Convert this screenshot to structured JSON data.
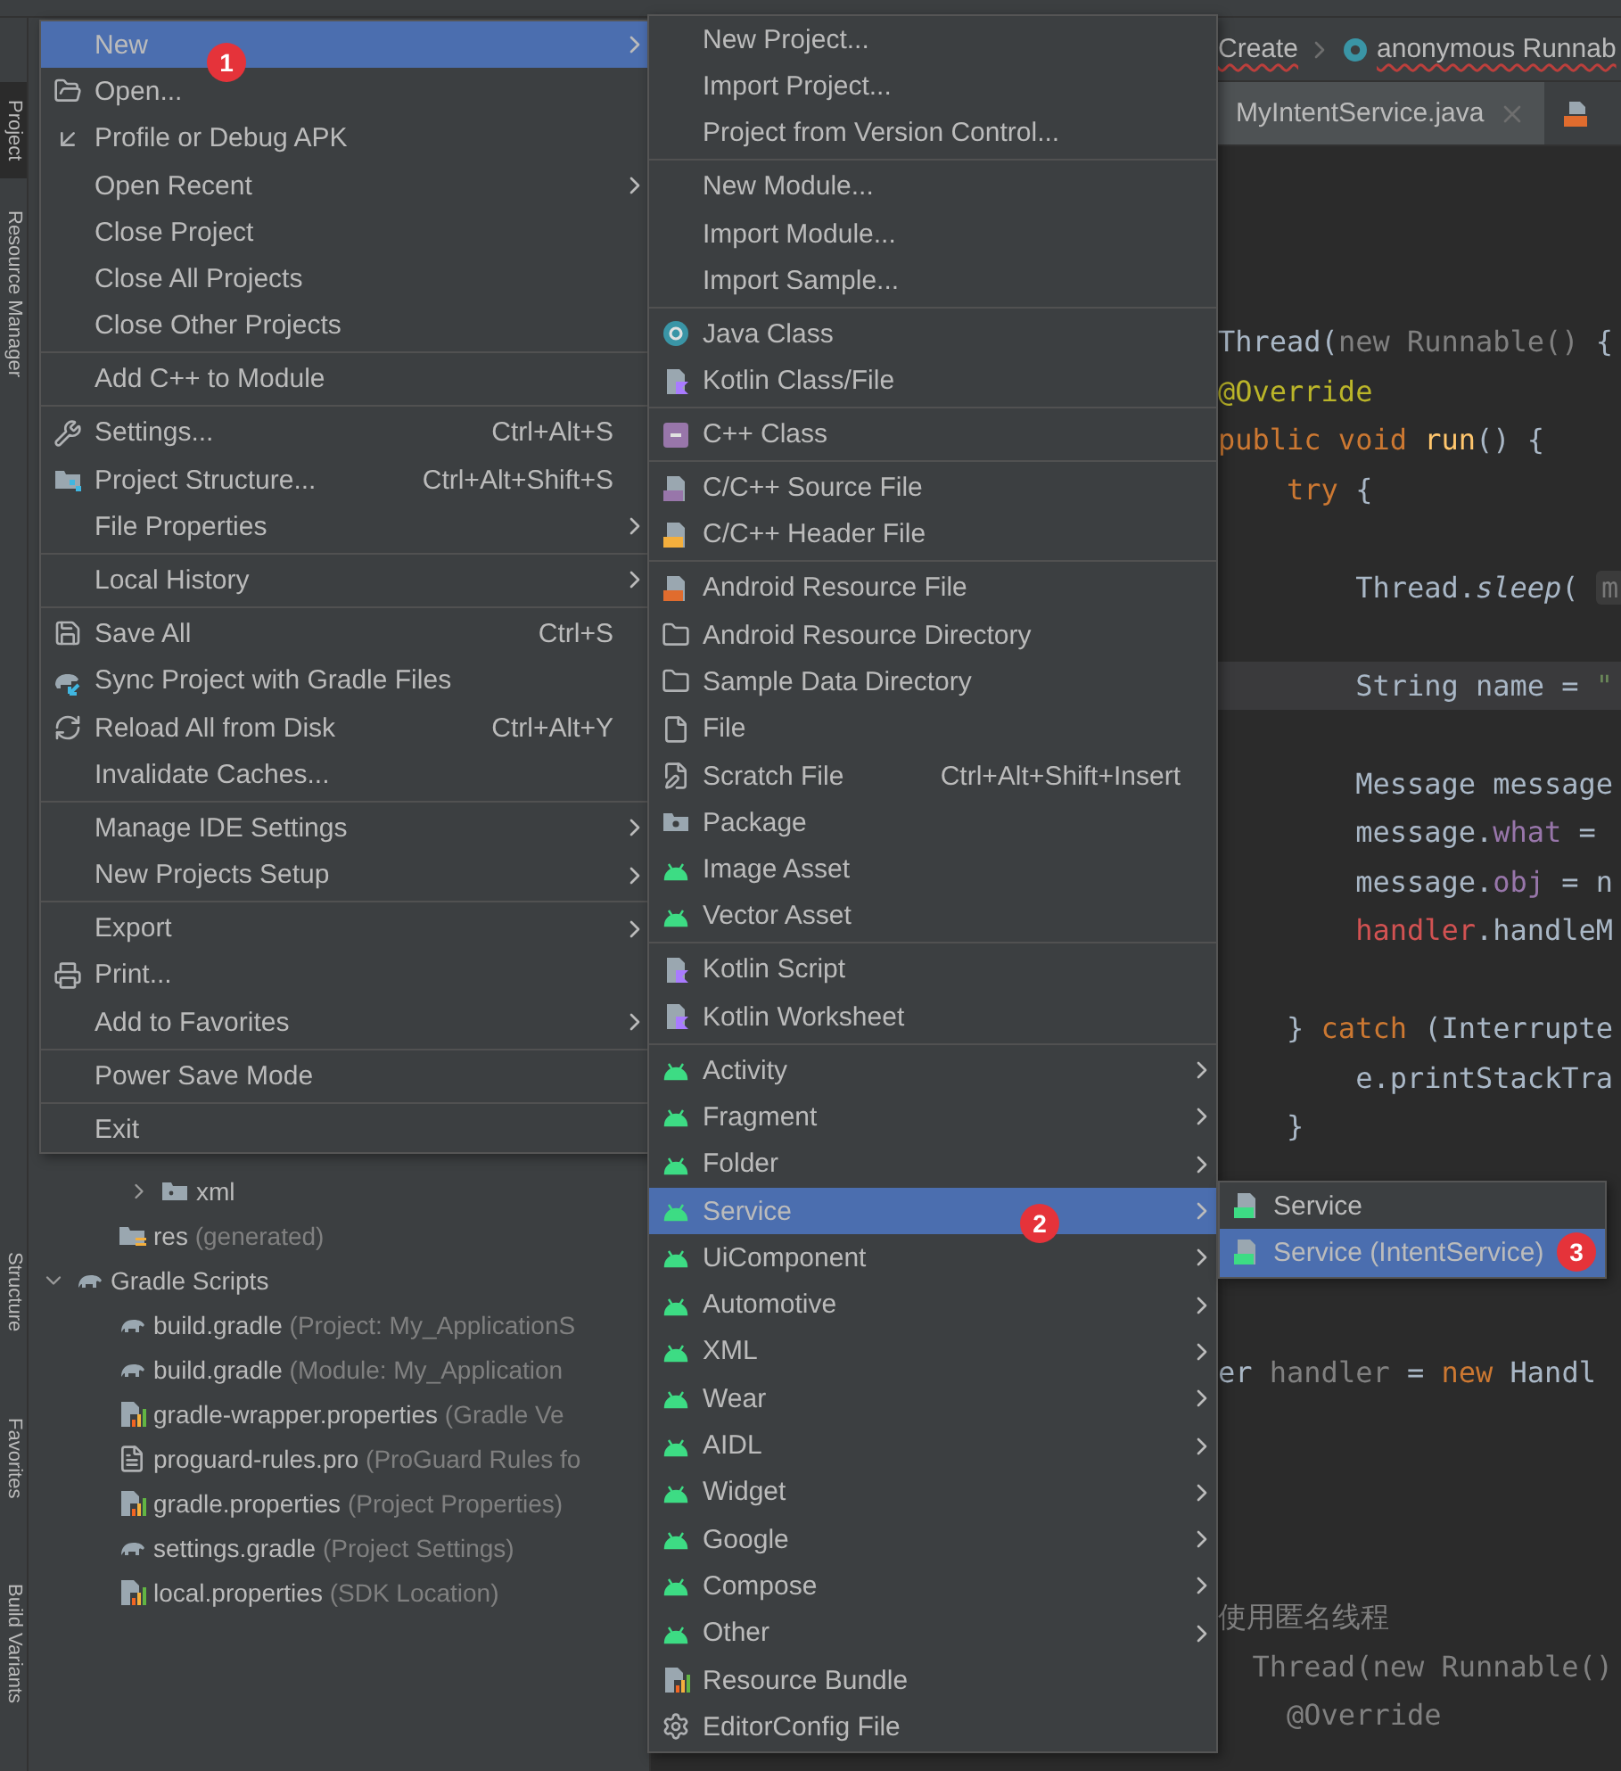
{
  "side_strip": {
    "top_tabs": [
      {
        "label": "Project",
        "selected": true
      },
      {
        "label": "Resource Manager",
        "selected": false
      }
    ],
    "bottom_tabs": [
      {
        "label": "Structure",
        "selected": false
      },
      {
        "label": "Favorites",
        "selected": false
      },
      {
        "label": "Build Variants",
        "selected": false
      }
    ]
  },
  "tree": [
    {
      "children": [
        {
          "children": [
            {
              "label": "xml",
              "expanded": false
            }
          ]
        },
        {
          "label": "res",
          "note": "(generated)"
        }
      ]
    },
    {
      "label": "Gradle Scripts",
      "expanded": true,
      "children": [
        {
          "label": "build.gradle",
          "note": "(Project: My_ApplicationS"
        },
        {
          "label": "build.gradle",
          "note": "(Module: My_Application"
        },
        {
          "label": "gradle-wrapper.properties",
          "note": "(Gradle Ve"
        },
        {
          "label": "proguard-rules.pro",
          "note": "(ProGuard Rules fo"
        },
        {
          "label": "gradle.properties",
          "note": "(Project Properties)"
        },
        {
          "label": "settings.gradle",
          "note": "(Project Settings)"
        },
        {
          "label": "local.properties",
          "note": "(SDK Location)"
        }
      ]
    }
  ],
  "breadcrumb": [
    {
      "label": "Create",
      "error": true
    },
    {
      "label": "anonymous Runnab",
      "error": true
    }
  ],
  "editor_tabs": [
    {
      "label": "MyIntentService.java",
      "selected": true
    }
  ],
  "code_lines": [
    {
      "kind": "code",
      "current": false,
      "segments": [
        {
          "kind": "plain",
          "text": "Thread("
        },
        {
          "kind": "muted",
          "text": "new Runnable()"
        },
        {
          "kind": "plain",
          "text": " {"
        }
      ]
    },
    {
      "kind": "code",
      "current": false,
      "segments": [
        {
          "kind": "annotation",
          "text": "@Override"
        }
      ]
    },
    {
      "kind": "code",
      "current": false,
      "segments": [
        {
          "kind": "keyword",
          "text": "public void "
        },
        {
          "kind": "method",
          "text": "run"
        },
        {
          "kind": "plain",
          "text": "() {"
        }
      ]
    },
    {
      "kind": "code",
      "current": false,
      "segments": [
        {
          "kind": "keyword",
          "text": "    try"
        },
        {
          "kind": "plain",
          "text": " {"
        }
      ]
    },
    {
      "kind": "blank"
    },
    {
      "kind": "code",
      "current": false,
      "segments": [
        {
          "kind": "plain",
          "text": "        Thread."
        },
        {
          "kind": "static",
          "text": "sleep"
        },
        {
          "kind": "plain",
          "text": "( "
        },
        {
          "kind": "hint",
          "text": "m"
        }
      ]
    },
    {
      "kind": "blank"
    },
    {
      "kind": "code",
      "current": true,
      "segments": [
        {
          "kind": "plain",
          "text": "        String name = "
        },
        {
          "kind": "string",
          "text": "\""
        }
      ]
    },
    {
      "kind": "blank"
    },
    {
      "kind": "code",
      "current": false,
      "segments": [
        {
          "kind": "plain",
          "text": "        Message message"
        }
      ]
    },
    {
      "kind": "code",
      "current": false,
      "segments": [
        {
          "kind": "plain",
          "text": "        message."
        },
        {
          "kind": "field",
          "text": "what"
        },
        {
          "kind": "plain",
          "text": " ="
        }
      ]
    },
    {
      "kind": "code",
      "current": false,
      "segments": [
        {
          "kind": "plain",
          "text": "        message."
        },
        {
          "kind": "field",
          "text": "obj"
        },
        {
          "kind": "plain",
          "text": " = n"
        }
      ]
    },
    {
      "kind": "code",
      "current": false,
      "segments": [
        {
          "kind": "error",
          "text": "        handler"
        },
        {
          "kind": "plain",
          "text": ".handleM"
        }
      ]
    },
    {
      "kind": "blank"
    },
    {
      "kind": "code",
      "current": false,
      "segments": [
        {
          "kind": "plain",
          "text": "    } "
        },
        {
          "kind": "keyword",
          "text": "catch"
        },
        {
          "kind": "plain",
          "text": " (Interrupte"
        }
      ]
    },
    {
      "kind": "code",
      "current": false,
      "segments": [
        {
          "kind": "plain",
          "text": "        e.printStackTra"
        }
      ]
    },
    {
      "kind": "code",
      "current": false,
      "segments": [
        {
          "kind": "plain",
          "text": "    }"
        }
      ]
    },
    {
      "kind": "blank"
    },
    {
      "kind": "blank"
    },
    {
      "kind": "blank"
    },
    {
      "kind": "blank"
    },
    {
      "kind": "code",
      "current": false,
      "segments": [
        {
          "kind": "plain",
          "text": "er "
        },
        {
          "kind": "muted",
          "text": "handler"
        },
        {
          "kind": "plain",
          "text": " = "
        },
        {
          "kind": "keyword",
          "text": "new"
        },
        {
          "kind": "plain",
          "text": " Handl"
        }
      ]
    },
    {
      "kind": "blank"
    },
    {
      "kind": "blank"
    },
    {
      "kind": "blank"
    },
    {
      "kind": "blank"
    },
    {
      "kind": "code",
      "current": false,
      "segments": [
        {
          "kind": "comment",
          "text": "使用匿名线程"
        }
      ]
    },
    {
      "kind": "code",
      "current": false,
      "segments": [
        {
          "kind": "muted",
          "text": "  Thread(new Runnable()"
        }
      ]
    },
    {
      "kind": "code",
      "current": false,
      "segments": [
        {
          "kind": "muted",
          "text": "    @Override"
        }
      ]
    }
  ],
  "file_menu": {
    "items": [
      {
        "label": "New",
        "selected": true,
        "submenu": true
      },
      {
        "label": "Open...",
        "selected": false,
        "submenu": false
      },
      {
        "label": "Profile or Debug APK",
        "selected": false,
        "submenu": false
      },
      {
        "label": "Open Recent",
        "selected": false,
        "submenu": true
      },
      {
        "label": "Close Project",
        "selected": false,
        "submenu": false
      },
      {
        "label": "Close All Projects",
        "selected": false,
        "submenu": false
      },
      {
        "label": "Close Other Projects",
        "selected": false,
        "submenu": false
      },
      {
        "kind": "separator"
      },
      {
        "label": "Add C++ to Module",
        "selected": false,
        "submenu": false
      },
      {
        "kind": "separator"
      },
      {
        "label": "Settings...",
        "shortcut": "Ctrl+Alt+S",
        "selected": false,
        "submenu": false
      },
      {
        "label": "Project Structure...",
        "shortcut": "Ctrl+Alt+Shift+S",
        "selected": false,
        "submenu": false
      },
      {
        "label": "File Properties",
        "selected": false,
        "submenu": true
      },
      {
        "kind": "separator"
      },
      {
        "label": "Local History",
        "selected": false,
        "submenu": true
      },
      {
        "kind": "separator"
      },
      {
        "label": "Save All",
        "shortcut": "Ctrl+S",
        "selected": false,
        "submenu": false
      },
      {
        "label": "Sync Project with Gradle Files",
        "selected": false,
        "submenu": false
      },
      {
        "label": "Reload All from Disk",
        "shortcut": "Ctrl+Alt+Y",
        "selected": false,
        "submenu": false
      },
      {
        "label": "Invalidate Caches...",
        "selected": false,
        "submenu": false
      },
      {
        "kind": "separator"
      },
      {
        "label": "Manage IDE Settings",
        "selected": false,
        "submenu": true
      },
      {
        "label": "New Projects Setup",
        "selected": false,
        "submenu": true
      },
      {
        "kind": "separator"
      },
      {
        "label": "Export",
        "selected": false,
        "submenu": true
      },
      {
        "label": "Print...",
        "selected": false,
        "submenu": false
      },
      {
        "label": "Add to Favorites",
        "selected": false,
        "submenu": true
      },
      {
        "kind": "separator"
      },
      {
        "label": "Power Save Mode",
        "selected": false,
        "submenu": false
      },
      {
        "kind": "separator"
      },
      {
        "label": "Exit",
        "selected": false,
        "submenu": false
      }
    ]
  },
  "new_menu": {
    "items": [
      {
        "label": "New Project...",
        "selected": false,
        "submenu": false
      },
      {
        "label": "Import Project...",
        "selected": false,
        "submenu": false
      },
      {
        "label": "Project from Version Control...",
        "selected": false,
        "submenu": false
      },
      {
        "kind": "separator"
      },
      {
        "label": "New Module...",
        "selected": false,
        "submenu": false
      },
      {
        "label": "Import Module...",
        "selected": false,
        "submenu": false
      },
      {
        "label": "Import Sample...",
        "selected": false,
        "submenu": false
      },
      {
        "kind": "separator"
      },
      {
        "label": "Java Class",
        "selected": false,
        "submenu": false
      },
      {
        "label": "Kotlin Class/File",
        "selected": false,
        "submenu": false
      },
      {
        "kind": "separator"
      },
      {
        "label": "C++ Class",
        "selected": false,
        "submenu": false
      },
      {
        "kind": "separator"
      },
      {
        "label": "C/C++ Source File",
        "selected": false,
        "submenu": false
      },
      {
        "label": "C/C++ Header File",
        "selected": false,
        "submenu": false
      },
      {
        "kind": "separator"
      },
      {
        "label": "Android Resource File",
        "selected": false,
        "submenu": false
      },
      {
        "label": "Android Resource Directory",
        "selected": false,
        "submenu": false
      },
      {
        "label": "Sample Data Directory",
        "selected": false,
        "submenu": false
      },
      {
        "label": "File",
        "selected": false,
        "submenu": false
      },
      {
        "label": "Scratch File",
        "shortcut": "Ctrl+Alt+Shift+Insert",
        "selected": false,
        "submenu": false
      },
      {
        "label": "Package",
        "selected": false,
        "submenu": false
      },
      {
        "label": "Image Asset",
        "selected": false,
        "submenu": false
      },
      {
        "label": "Vector Asset",
        "selected": false,
        "submenu": false
      },
      {
        "kind": "separator"
      },
      {
        "label": "Kotlin Script",
        "selected": false,
        "submenu": false
      },
      {
        "label": "Kotlin Worksheet",
        "selected": false,
        "submenu": false
      },
      {
        "kind": "separator"
      },
      {
        "label": "Activity",
        "selected": false,
        "submenu": true
      },
      {
        "label": "Fragment",
        "selected": false,
        "submenu": true
      },
      {
        "label": "Folder",
        "selected": false,
        "submenu": true
      },
      {
        "label": "Service",
        "selected": true,
        "submenu": true
      },
      {
        "label": "UiComponent",
        "selected": false,
        "submenu": true
      },
      {
        "label": "Automotive",
        "selected": false,
        "submenu": true
      },
      {
        "label": "XML",
        "selected": false,
        "submenu": true
      },
      {
        "label": "Wear",
        "selected": false,
        "submenu": true
      },
      {
        "label": "AIDL",
        "selected": false,
        "submenu": true
      },
      {
        "label": "Widget",
        "selected": false,
        "submenu": true
      },
      {
        "label": "Google",
        "selected": false,
        "submenu": true
      },
      {
        "label": "Compose",
        "selected": false,
        "submenu": true
      },
      {
        "label": "Other",
        "selected": false,
        "submenu": true
      },
      {
        "label": "Resource Bundle",
        "selected": false,
        "submenu": false
      },
      {
        "label": "EditorConfig File",
        "selected": false,
        "submenu": false
      }
    ]
  },
  "service_menu": {
    "items": [
      {
        "label": "Service",
        "selected": false,
        "submenu": false
      },
      {
        "label": "Service (IntentService)",
        "selected": true,
        "submenu": false
      }
    ]
  },
  "badges": [
    {
      "label": "1"
    },
    {
      "label": "2"
    },
    {
      "label": "3"
    }
  ]
}
